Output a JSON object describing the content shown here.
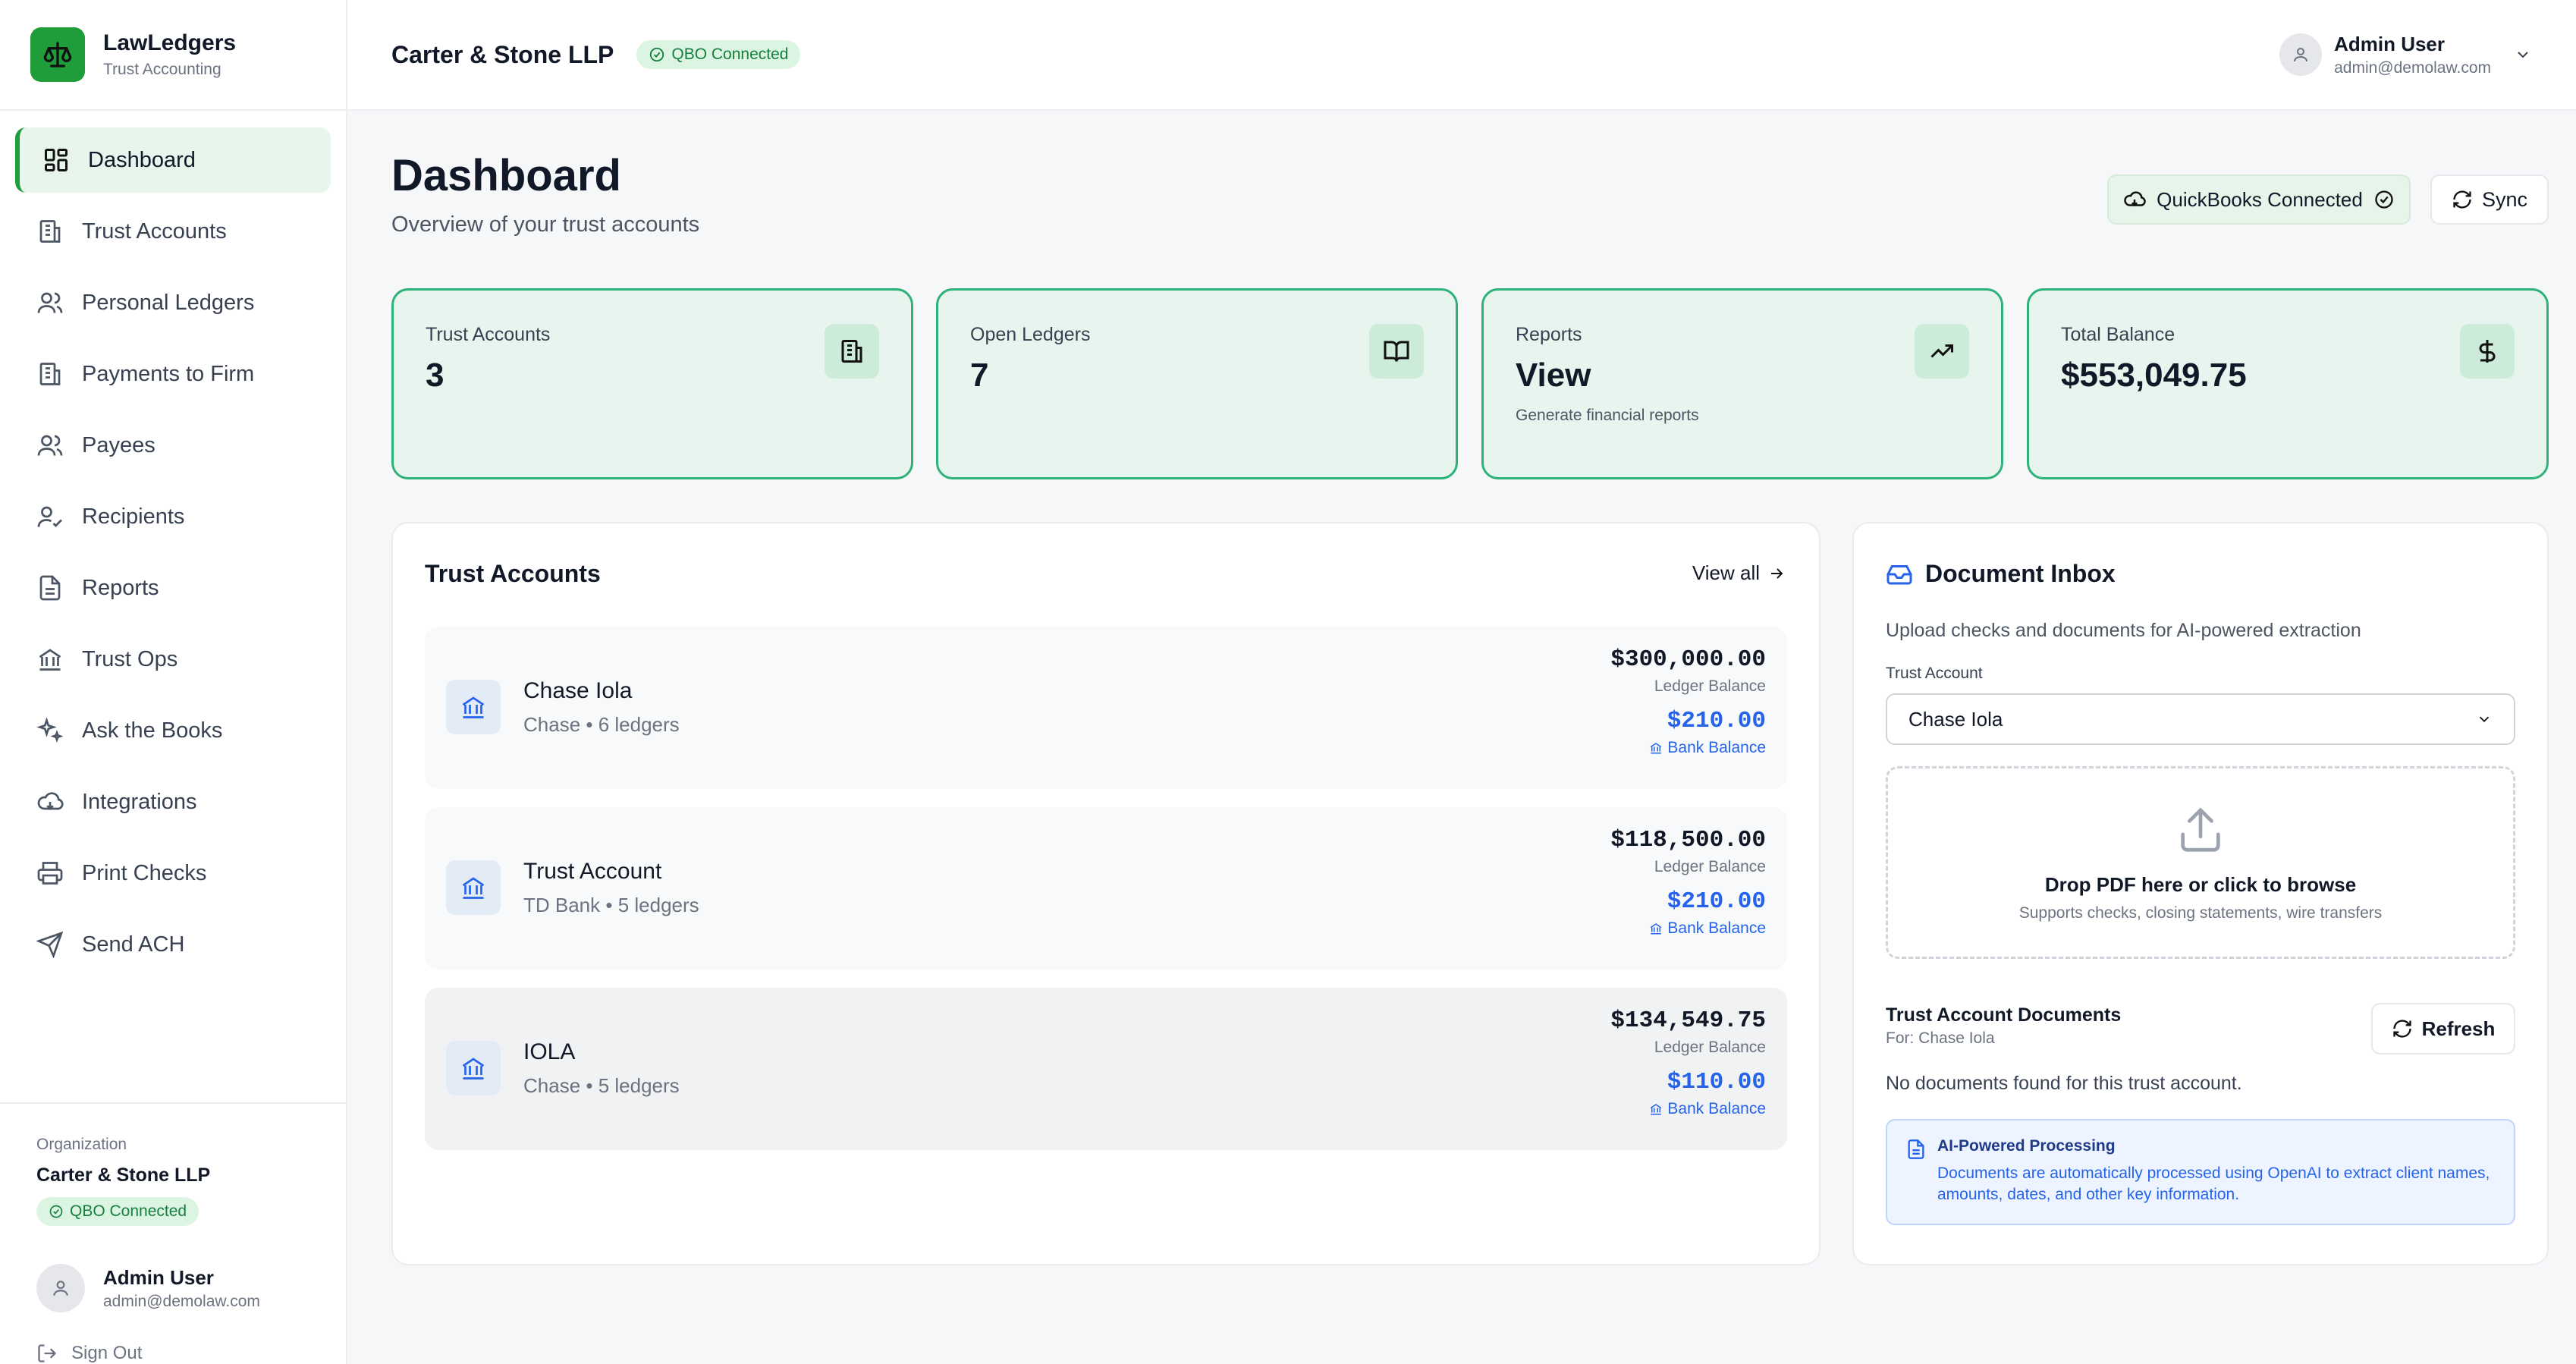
{
  "brand": {
    "name": "LawLedgers",
    "subtitle": "Trust Accounting"
  },
  "nav": [
    {
      "label": "Dashboard",
      "icon": "dashboard-icon",
      "active": true
    },
    {
      "label": "Trust Accounts",
      "icon": "building-icon"
    },
    {
      "label": "Personal Ledgers",
      "icon": "users-icon"
    },
    {
      "label": "Payments to Firm",
      "icon": "building-icon"
    },
    {
      "label": "Payees",
      "icon": "users-icon"
    },
    {
      "label": "Recipients",
      "icon": "user-check-icon"
    },
    {
      "label": "Reports",
      "icon": "file-icon"
    },
    {
      "label": "Trust Ops",
      "icon": "bank-icon"
    },
    {
      "label": "Ask the Books",
      "icon": "sparkles-icon"
    },
    {
      "label": "Integrations",
      "icon": "cloud-icon"
    },
    {
      "label": "Print Checks",
      "icon": "printer-icon"
    },
    {
      "label": "Send ACH",
      "icon": "send-icon"
    }
  ],
  "org": {
    "label": "Organization",
    "name": "Carter & Stone LLP",
    "status": "QBO Connected"
  },
  "user": {
    "name": "Admin User",
    "email": "admin@demolaw.com",
    "signout": "Sign Out"
  },
  "header": {
    "firm": "Carter & Stone LLP",
    "status": "QBO Connected"
  },
  "page": {
    "title": "Dashboard",
    "subtitle": "Overview of your trust accounts",
    "qb_button": "QuickBooks Connected",
    "sync_button": "Sync"
  },
  "stats": [
    {
      "label": "Trust Accounts",
      "value": "3",
      "note": "",
      "icon": "building-icon"
    },
    {
      "label": "Open Ledgers",
      "value": "7",
      "note": "",
      "icon": "book-icon"
    },
    {
      "label": "Reports",
      "value": "View",
      "note": "Generate financial reports",
      "icon": "trending-up-icon"
    },
    {
      "label": "Total Balance",
      "value": "$553,049.75",
      "note": "",
      "icon": "dollar-icon"
    }
  ],
  "trust_accounts": {
    "title": "Trust Accounts",
    "view_all": "View all",
    "ledger_label": "Ledger Balance",
    "bank_label": "Bank Balance",
    "items": [
      {
        "name": "Chase Iola",
        "meta": "Chase • 6 ledgers",
        "ledger_balance": "$300,000.00",
        "bank_balance": "$210.00"
      },
      {
        "name": "Trust Account",
        "meta": "TD Bank • 5 ledgers",
        "ledger_balance": "$118,500.00",
        "bank_balance": "$210.00"
      },
      {
        "name": "IOLA",
        "meta": "Chase • 5 ledgers",
        "ledger_balance": "$134,549.75",
        "bank_balance": "$110.00"
      }
    ]
  },
  "inbox": {
    "title": "Document Inbox",
    "description": "Upload checks and documents for AI-powered extraction",
    "field_label": "Trust Account",
    "selected_account": "Chase Iola",
    "drop_main": "Drop PDF here or click to browse",
    "drop_sub": "Supports checks, closing statements, wire transfers",
    "docs_title": "Trust Account Documents",
    "docs_for": "For: Chase Iola",
    "refresh": "Refresh",
    "no_docs": "No documents found for this trust account.",
    "ai_title": "AI-Powered Processing",
    "ai_text": "Documents are automatically processed using OpenAI to extract client names, amounts, dates, and other key information."
  },
  "colors": {
    "brand": "#1f9d3a",
    "accent_blue": "#2563eb",
    "stat_border": "#2fb17a"
  }
}
